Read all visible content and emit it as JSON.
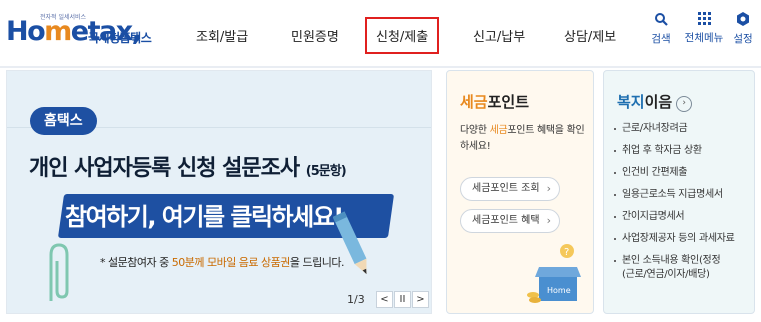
{
  "logo": {
    "tagline": "전자적 일세서비스",
    "name": "Hometax",
    "subtitle": "국세청홈택스"
  },
  "gnb": {
    "items": [
      {
        "label": "조회/발급",
        "active": false
      },
      {
        "label": "민원증명",
        "active": false
      },
      {
        "label": "신청/제출",
        "active": true
      },
      {
        "label": "신고/납부",
        "active": false
      },
      {
        "label": "상담/제보",
        "active": false
      }
    ]
  },
  "util": {
    "search": "검색",
    "menu": "전체메뉴",
    "settings": "설정"
  },
  "banner": {
    "badge": "홈택스",
    "title": "개인 사업자등록 신청 설문조사",
    "title_suffix": "(5문항)",
    "cta": "참여하기, 여기를 클릭하세요!",
    "note_prefix": "* 설문참여자 중 ",
    "note_highlight": "50분께 모바일 음료 상품권",
    "note_suffix": "을 드립니다.",
    "pager": {
      "current": 1,
      "total": 3,
      "text": "1/3",
      "prev": "<",
      "pause": "II",
      "next": ">"
    }
  },
  "tax_point": {
    "title_a": "세금",
    "title_b": "포인트",
    "desc_a": "다양한 ",
    "desc_highlight": "세금",
    "desc_b": "포인트 혜택을 확인하세요!",
    "buttons": [
      "세금포인트 조회",
      "세금포인트 혜택"
    ],
    "box_label": "Home"
  },
  "welfare": {
    "title_a": "복지",
    "title_b": "이음",
    "items": [
      "근로/자녀장려금",
      "취업 후 학자금 상환",
      "인건비 간편제출",
      "일용근로소득 지급명세서",
      "간이지급명세서",
      "사업장제공자 등의 과세자료",
      "본인 소득내용 확인(정정",
      "(근로/연금/이자/배당)"
    ]
  },
  "colors": {
    "brand_blue": "#1b4fa4",
    "accent_orange": "#e8891f",
    "active_border": "#e0201f",
    "banner_bg": "#e6f0f7"
  }
}
